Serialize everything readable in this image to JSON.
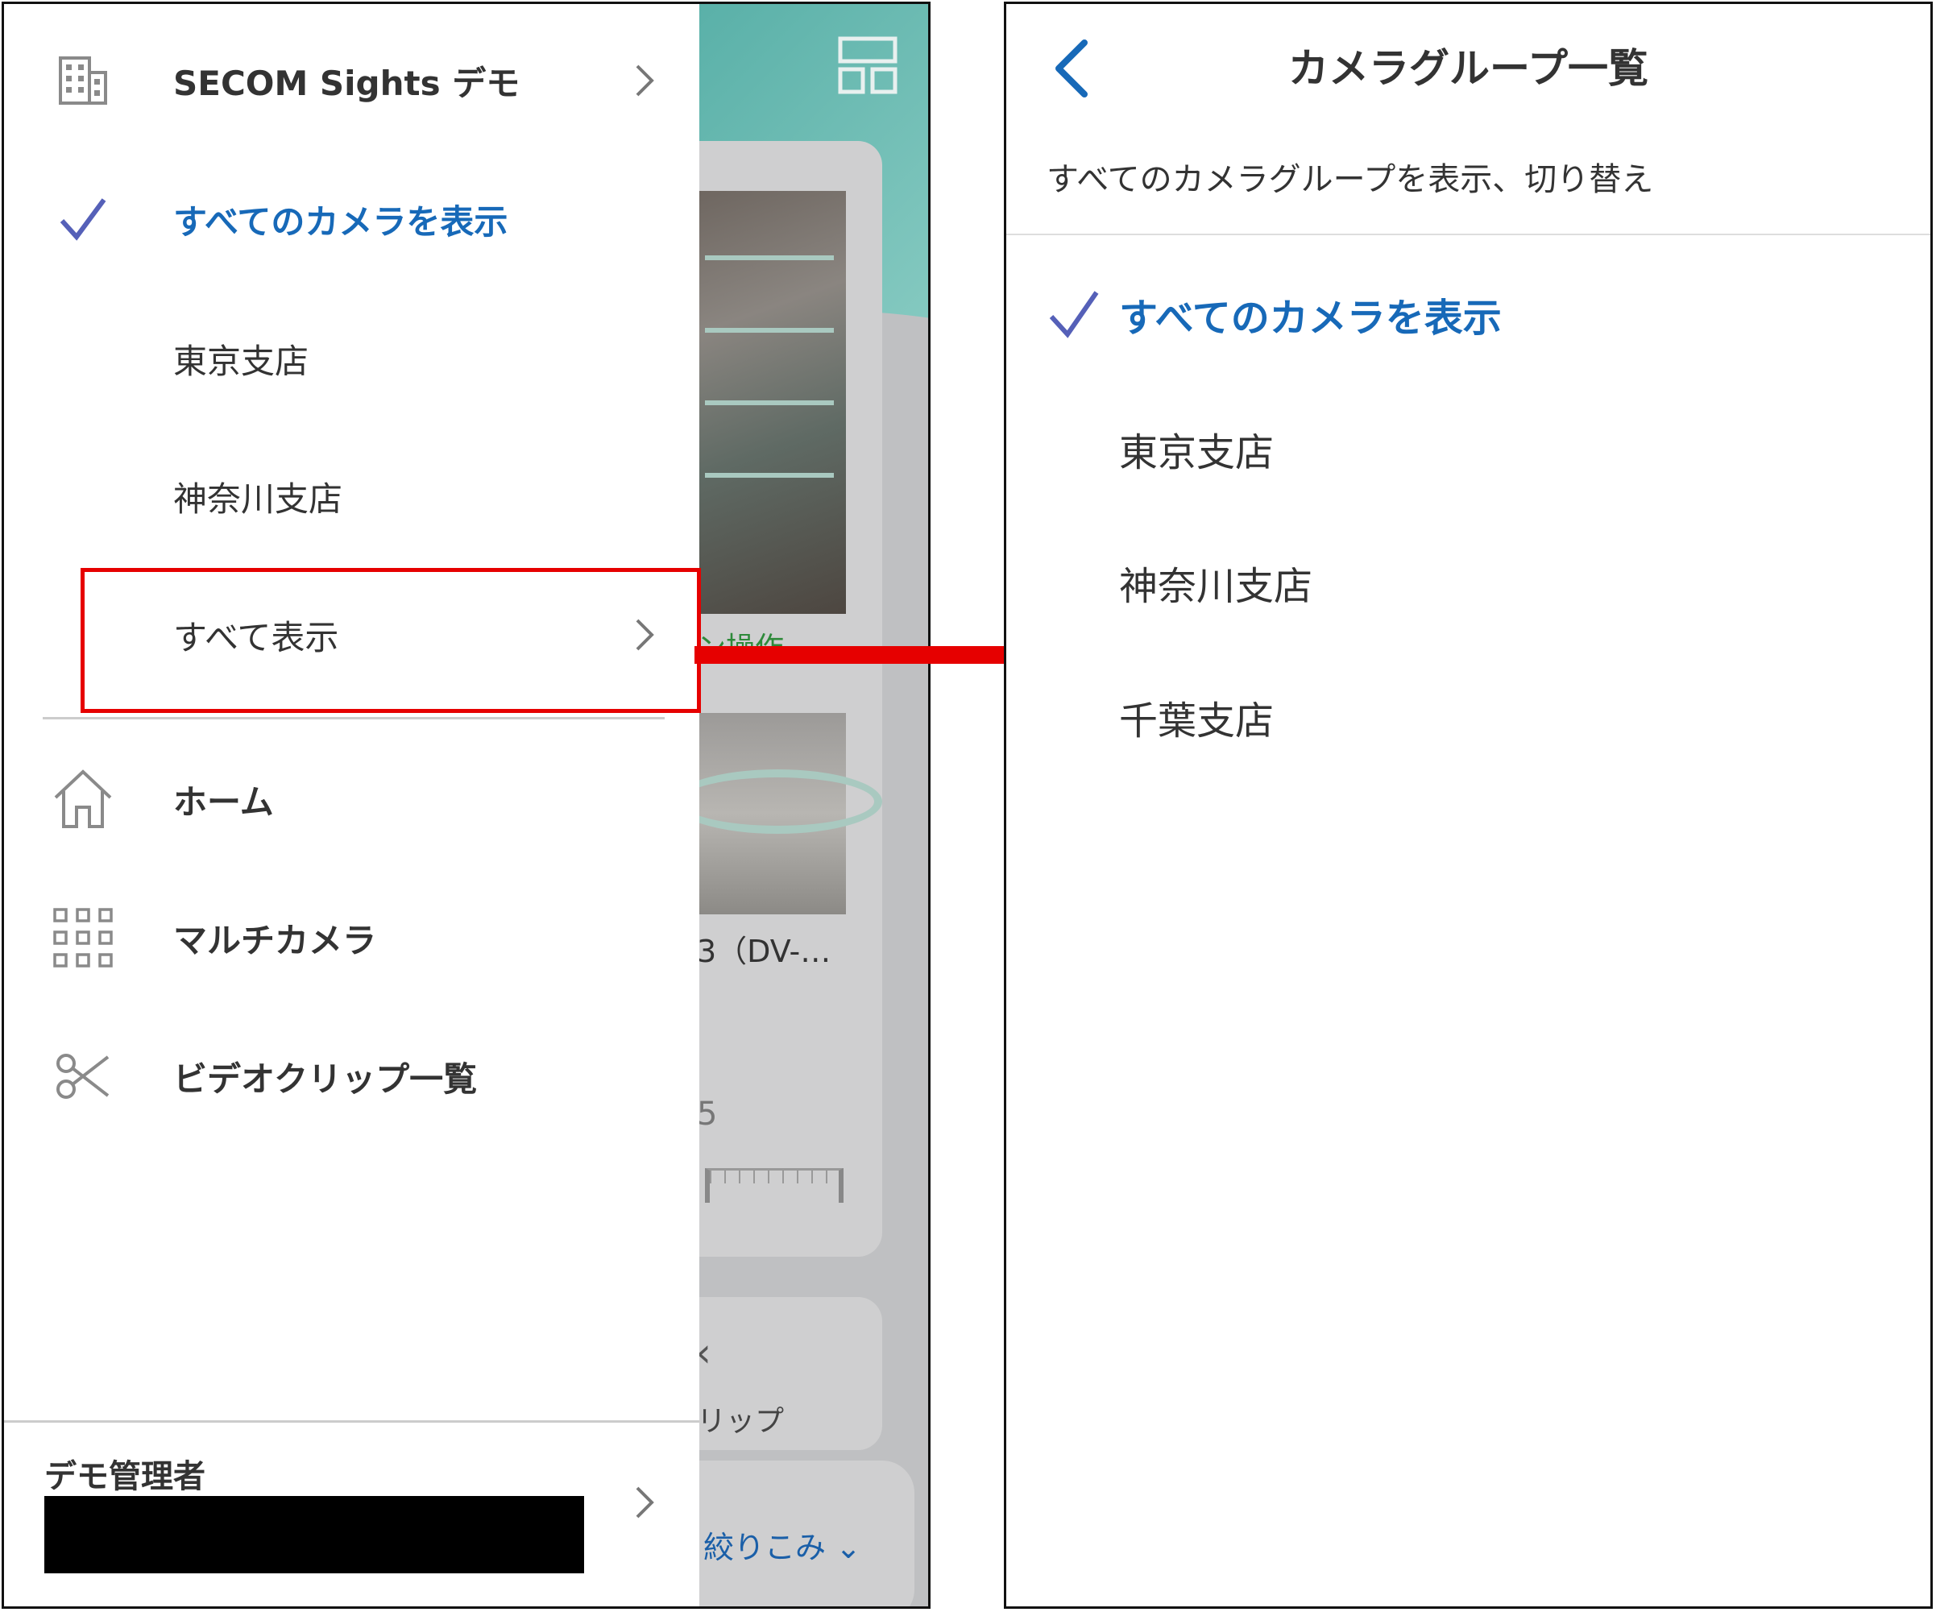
{
  "drawer": {
    "org_name": "SECOM Sights デモ",
    "groups": [
      {
        "label": "すべてのカメラを表示",
        "selected": true
      },
      {
        "label": "東京支店",
        "selected": false
      },
      {
        "label": "神奈川支店",
        "selected": false
      }
    ],
    "show_all_label": "すべて表示",
    "nav": [
      {
        "label": "ホーム",
        "icon": "home-icon"
      },
      {
        "label": "マルチカメラ",
        "icon": "grid-icon"
      },
      {
        "label": "ビデオクリップ一覧",
        "icon": "scissors-icon"
      }
    ],
    "user_name": "デモ管理者"
  },
  "background_app": {
    "ops_text": "ン操作",
    "camera_name": "3（DV-…",
    "number_text": "5",
    "clip_text": "リップ",
    "filter_label": "絞りこみ"
  },
  "group_list": {
    "title": "カメラグループ一覧",
    "subtitle": "すべてのカメラグループを表示、切り替え",
    "items": [
      {
        "label": "すべてのカメラを表示",
        "selected": true
      },
      {
        "label": "東京支店",
        "selected": false
      },
      {
        "label": "神奈川支店",
        "selected": false
      },
      {
        "label": "千葉支店",
        "selected": false
      }
    ]
  },
  "colors": {
    "accent_blue": "#1769b8",
    "check_purple": "#5560b8",
    "highlight_red": "#e60000",
    "header_teal": "#59b0a8"
  }
}
